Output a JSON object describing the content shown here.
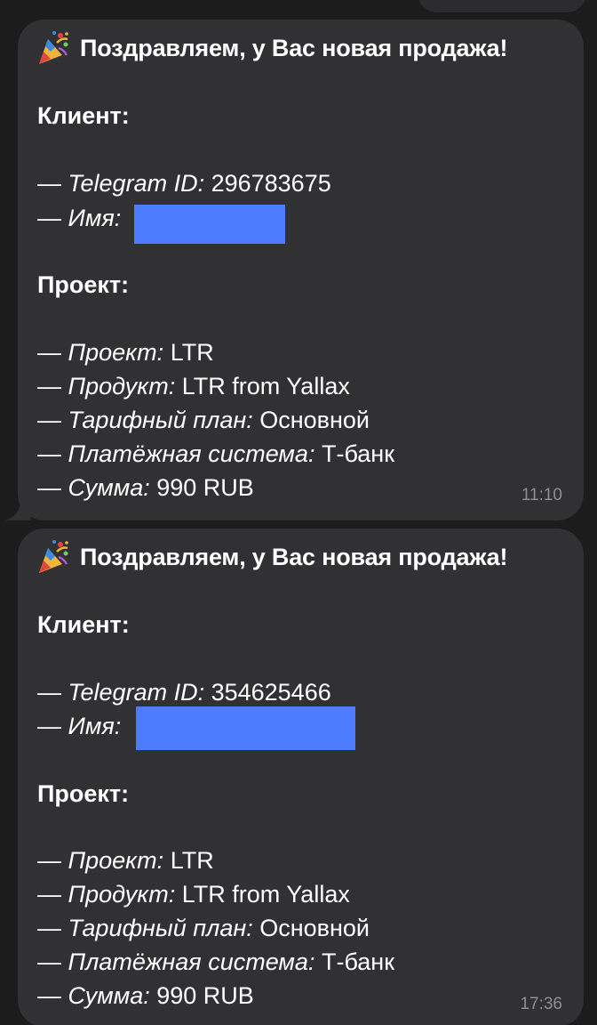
{
  "messages": [
    {
      "header": "Поздравляем, у Вас новая продажа!",
      "client_title": "Клиент:",
      "telegram_label": "Telegram ID:",
      "telegram_value": " 296783675",
      "name_label": "Имя:",
      "project_title": "Проект:",
      "project_label": "Проект:",
      "project_value": " LTR",
      "product_label": "Продукт:",
      "product_value": " LTR from Yallax",
      "plan_label": "Тарифный план:",
      "plan_value": " Основной",
      "payment_label": "Платёжная система:",
      "payment_value": " Т-банк",
      "sum_label": "Сумма:",
      "sum_value": " 990 RUB",
      "time": "11:10"
    },
    {
      "header": "Поздравляем, у Вас новая продажа!",
      "client_title": "Клиент:",
      "telegram_label": "Telegram ID:",
      "telegram_value": " 354625466",
      "name_label": "Имя:",
      "project_title": "Проект:",
      "project_label": "Проект:",
      "project_value": " LTR",
      "product_label": "Продукт:",
      "product_value": " LTR from Yallax",
      "plan_label": "Тарифный план:",
      "plan_value": " Основной",
      "payment_label": "Платёжная система:",
      "payment_value": " Т-банк",
      "sum_label": "Сумма:",
      "sum_value": " 990 RUB",
      "time": "17:36"
    }
  ],
  "dash": "— ",
  "icons": {
    "header": "party-popper-icon"
  },
  "colors": {
    "background": "#1c1c1d",
    "bubble": "#313133",
    "redaction": "#4d7cfe",
    "timestamp": "#8e8e93"
  }
}
